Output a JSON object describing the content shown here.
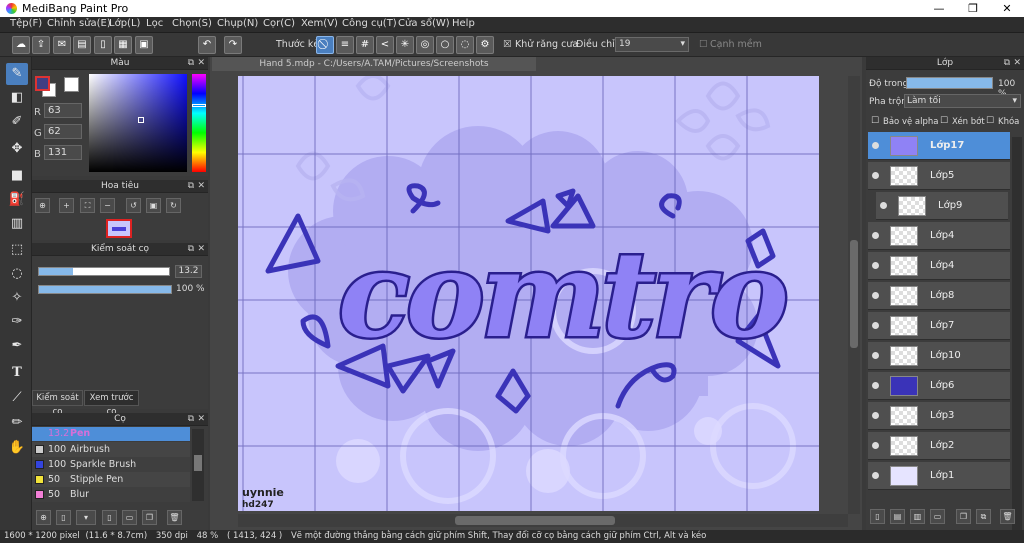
{
  "app": {
    "title": "MediBang Paint Pro"
  },
  "window_controls": [
    "—",
    "❐",
    "✕"
  ],
  "menu": [
    "Tệp(F)",
    "Chỉnh sửa(E)",
    "Lớp(L)",
    "Lọc",
    "Chọn(S)",
    "Chụp(N)",
    "Cọr(C)",
    "Xem(V)",
    "Công cụ(T)",
    "Cửa sổ(W)",
    "Help"
  ],
  "toolbar": {
    "ruler_label": "Thước kẻ",
    "antialias_label": "Khử răng cưa",
    "correction_label": "Điều chỉnh",
    "correction_value": "19",
    "edge_label": "Cạnh mềm"
  },
  "color_panel": {
    "title": "Màu",
    "r_label": "R",
    "r": "63",
    "g_label": "G",
    "g": "62",
    "b_label": "B",
    "b": "131",
    "fg_color": "#3f3e83",
    "bg_color": "#ffffff"
  },
  "navigator": {
    "title": "Hoa tiêu"
  },
  "brush_control": {
    "title": "Kiểm soát cọ",
    "size_value": "13.2",
    "size_fraction": 0.26,
    "opacity_value": "100 %",
    "opacity_fraction": 1.0,
    "tab_control": "Kiểm soát cọ",
    "tab_preview": "Xem trước cọ"
  },
  "brush_panel": {
    "title": "Cọ",
    "selected": {
      "size": "13.2",
      "name": "Pen"
    },
    "items": [
      {
        "size": "100",
        "name": "Airbrush",
        "color": "#cccccc"
      },
      {
        "size": "100",
        "name": "Sparkle Brush",
        "color": "#3344dd"
      },
      {
        "size": "50",
        "name": "Stipple Pen",
        "color": "#f2e33a"
      },
      {
        "size": "50",
        "name": "Blur",
        "color": "#f27fd6"
      }
    ]
  },
  "document": {
    "tab": "Hand 5.mdp - C:/Users/A.TAM/Pictures/Screenshots"
  },
  "artwork": {
    "word": "comtro",
    "signature_line1": "uynnie",
    "signature_line2": "hd247"
  },
  "layer_panel": {
    "title": "Lớp",
    "opacity_label": "Độ trong",
    "opacity_value": "100 %",
    "blend_label": "Pha trộn",
    "blend_value": "Làm tối",
    "protect_alpha": "Bảo vệ alpha",
    "clip": "Xén bớt",
    "lock": "Khóa",
    "layers": [
      {
        "name": "Lớp17",
        "selected": true
      },
      {
        "name": "Lớp5"
      },
      {
        "name": "Lớp9"
      },
      {
        "name": "Lớp4"
      },
      {
        "name": "Lớp4"
      },
      {
        "name": "Lớp8"
      },
      {
        "name": "Lớp7"
      },
      {
        "name": "Lớp10"
      },
      {
        "name": "Lớp6"
      },
      {
        "name": "Lớp3"
      },
      {
        "name": "Lớp2"
      },
      {
        "name": "Lớp1"
      }
    ]
  },
  "status": {
    "size": "1600 * 1200 pixel",
    "physical": "(11.6 * 8.7cm)",
    "dpi": "350 dpi",
    "zoom": "48 %",
    "coords": "( 1413, 424 )",
    "hint": "Vẽ một đường thẳng bằng cách giữ phím Shift, Thay đổi cỡ cọ bằng cách giữ phím Ctrl, Alt và kéo"
  }
}
